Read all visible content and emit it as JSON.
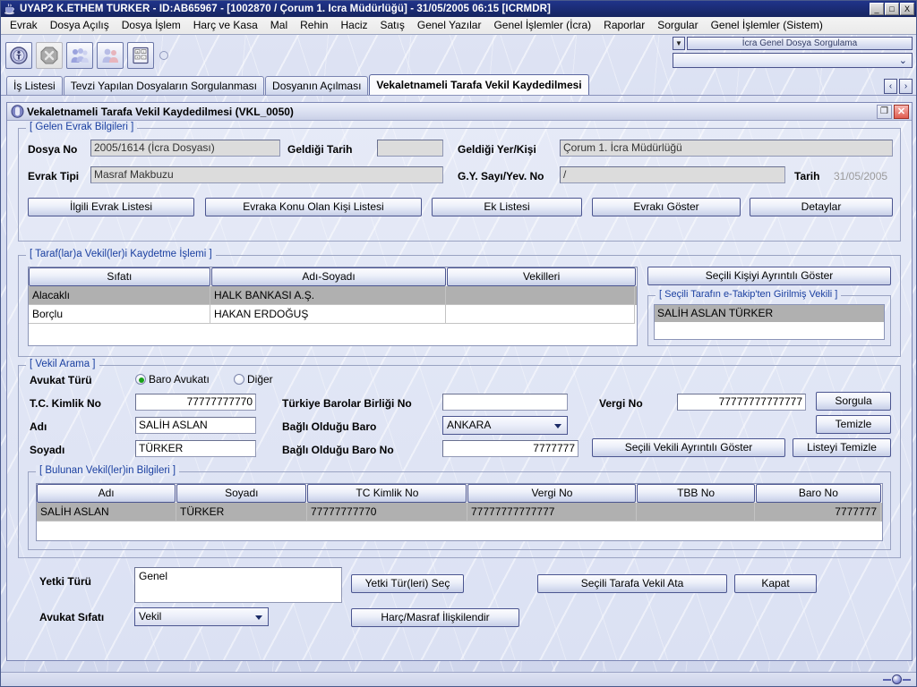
{
  "window": {
    "title": "UYAP2   K.ETHEM TÜRKER - ID:AB65967 - [1002870 / Çorum 1. İcra Müdürlüğü] - 31/05/2005 06:15 [ICRMDR]",
    "minimize": "_",
    "maximize": "□",
    "close": "X",
    "app_icon": "java-cup-icon"
  },
  "menubar": {
    "items": [
      {
        "label": "Evrak"
      },
      {
        "label": "Dosya Açılış"
      },
      {
        "label": "Dosya İşlem"
      },
      {
        "label": "Harç ve Kasa"
      },
      {
        "label": "Mal"
      },
      {
        "label": "Rehin"
      },
      {
        "label": "Haciz"
      },
      {
        "label": "Satış"
      },
      {
        "label": "Genel Yazılar"
      },
      {
        "label": "Genel İşlemler (İcra)"
      },
      {
        "label": "Raporlar"
      },
      {
        "label": "Sorgular"
      },
      {
        "label": "Genel İşlemler (Sistem)"
      }
    ]
  },
  "toolbar": {
    "icons": [
      {
        "name": "info-person-icon",
        "enabled": true
      },
      {
        "name": "cancel-octagon-icon",
        "enabled": false
      },
      {
        "name": "group-people-icon",
        "enabled": true
      },
      {
        "name": "two-people-icon",
        "enabled": true
      },
      {
        "name": "calculator-icon",
        "enabled": true
      }
    ],
    "quick_query_label": "İcra Genel Dosya Sorgulama",
    "quick_query_dropdown_value": "",
    "arrow_glyph": "▼"
  },
  "tabs": {
    "items": [
      {
        "label": "İş Listesi",
        "active": false
      },
      {
        "label": "Tevzi Yapılan Dosyaların Sorgulanması",
        "active": false
      },
      {
        "label": "Dosyanın Açılması",
        "active": false
      },
      {
        "label": "Vekaletnameli Tarafa Vekil Kaydedilmesi",
        "active": true
      }
    ],
    "nav_prev": "‹",
    "nav_next": "›"
  },
  "frame": {
    "title": "Vekaletnameli Tarafa Vekil Kaydedilmesi (VKL_0050)",
    "icon": "document-window-icon",
    "restore_label": "❐",
    "close_label": "✕"
  },
  "gelen_evrak": {
    "legend": "[ Gelen Evrak Bilgileri ]",
    "dosya_no_label": "Dosya No",
    "dosya_no_value": "2005/1614 (İcra Dosyası)",
    "geldigi_tarih_label": "Geldiği Tarih",
    "geldigi_tarih_value": "",
    "geldigi_yer_label": "Geldiği Yer/Kişi",
    "geldigi_yer_value": "Çorum 1. İcra Müdürlüğü",
    "evrak_tipi_label": "Evrak Tipi",
    "evrak_tipi_value": "Masraf Makbuzu",
    "gy_sayi_label": "G.Y. Sayı/Yev. No",
    "gy_sayi_value": "/",
    "tarih_label": "Tarih",
    "tarih_value": "31/05/2005",
    "buttons": [
      {
        "label": "İlgili Evrak Listesi"
      },
      {
        "label": "Evraka Konu Olan Kişi Listesi"
      },
      {
        "label": "Ek Listesi"
      },
      {
        "label": "Evrakı Göster"
      },
      {
        "label": "Detaylar"
      }
    ]
  },
  "taraf_vekil": {
    "legend": "[ Taraf(lar)a Vekil(ler)i Kaydetme İşlemi ]",
    "columns": [
      "Sıfatı",
      "Adı-Soyadı",
      "Vekilleri"
    ],
    "rows": [
      {
        "cells": [
          "Alacaklı",
          "HALK BANKASI A.Ş.",
          ""
        ],
        "selected": true
      },
      {
        "cells": [
          "Borçlu",
          "HAKAN ERDOĞUŞ",
          ""
        ],
        "selected": false
      }
    ],
    "detail_button": "Seçili Kişiyi Ayrıntılı Göster",
    "etakip_legend": "[ Seçili Tarafın e-Takip'ten Girilmiş Vekili ]",
    "etakip_items": [
      {
        "label": "SALİH ASLAN TÜRKER",
        "selected": true
      }
    ]
  },
  "vekil_arama": {
    "legend": "[ Vekil Arama ]",
    "avukat_turu_label": "Avukat Türü",
    "radio_baro": "Baro Avukatı",
    "radio_diger": "Diğer",
    "radio_selected": "Baro Avukatı",
    "tc_label": "T.C. Kimlik No",
    "tc_value": "77777777770",
    "adi_label": "Adı",
    "adi_value": "SALİH ASLAN",
    "soyadi_label": "Soyadı",
    "soyadi_value": "TÜRKER",
    "tbb_label": "Türkiye Barolar Birliği No",
    "tbb_value": "",
    "baro_label": "Bağlı Olduğu Baro",
    "baro_value": "ANKARA",
    "baro_no_label": "Bağlı Olduğu Baro No",
    "baro_no_value": "7777777",
    "vergi_label": "Vergi No",
    "vergi_value": "77777777777777",
    "btn_sorgula": "Sorgula",
    "btn_temizle": "Temizle",
    "btn_secili_vekil": "Seçili Vekili Ayrıntılı Göster",
    "btn_listeyi_temizle": "Listeyi Temizle"
  },
  "bulunan_vekiller": {
    "legend": "[ Bulunan Vekil(ler)in Bilgileri ]",
    "columns": [
      "Adı",
      "Soyadı",
      "TC Kimlik No",
      "Vergi No",
      "TBB No",
      "Baro No"
    ],
    "rows": [
      {
        "cells": [
          "SALİH ASLAN",
          "TÜRKER",
          "77777777770",
          "77777777777777",
          "",
          "7777777"
        ],
        "selected": true
      }
    ]
  },
  "bottom": {
    "yetki_turu_label": "Yetki Türü",
    "yetki_turu_value": "Genel",
    "btn_yetki_sec": "Yetki Tür(leri) Seç",
    "btn_vekil_ata": "Seçili Tarafa Vekil Ata",
    "btn_kapat": "Kapat",
    "avukat_sifati_label": "Avukat Sıfatı",
    "avukat_sifati_value": "Vekil",
    "btn_harc_masraf": "Harç/Masraf İlişkilendir"
  },
  "statusbar": {
    "indicator": "connection-indicator"
  },
  "colors": {
    "titlebar": "#1b2c75",
    "legend_text": "#1a3fa0",
    "selection_gray": "#b0b0b0",
    "radio_dot_green": "#18a018",
    "close_red": "#e05b4e"
  }
}
